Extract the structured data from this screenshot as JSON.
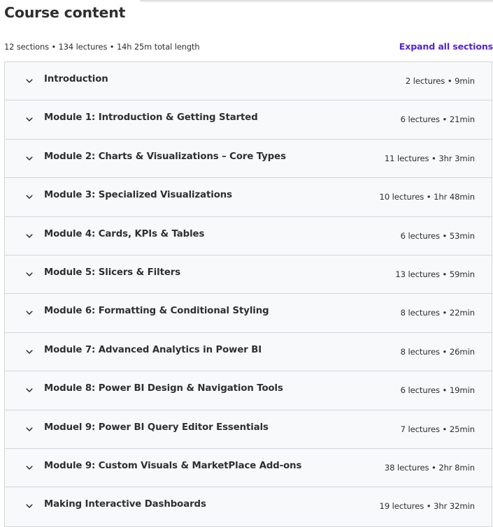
{
  "page_title": "Course content",
  "summary": "12 sections • 134 lectures • 14h 25m total length",
  "expand_all_label": "Expand all sections",
  "accent_color": "#5624d0",
  "sections": [
    {
      "title": "Introduction",
      "meta": "2 lectures • 9min"
    },
    {
      "title": "Module 1: Introduction & Getting Started",
      "meta": "6 lectures • 21min"
    },
    {
      "title": "Module 2: Charts & Visualizations – Core Types",
      "meta": "11 lectures • 3hr 3min"
    },
    {
      "title": "Module 3: Specialized Visualizations",
      "meta": "10 lectures • 1hr 48min"
    },
    {
      "title": "Module 4: Cards, KPIs & Tables",
      "meta": "6 lectures • 53min"
    },
    {
      "title": "Module 5: Slicers & Filters",
      "meta": "13 lectures • 59min"
    },
    {
      "title": "Module 6: Formatting & Conditional Styling",
      "meta": "8 lectures • 22min"
    },
    {
      "title": "Module 7: Advanced Analytics in Power BI",
      "meta": "8 lectures • 26min"
    },
    {
      "title": "Module 8: Power BI Design & Navigation Tools",
      "meta": "6 lectures • 19min"
    },
    {
      "title": "Moduel 9: Power BI Query Editor Essentials",
      "meta": "7 lectures • 25min"
    },
    {
      "title": "Module 9: Custom Visuals & MarketPlace Add-ons",
      "meta": "38 lectures • 2hr 8min"
    },
    {
      "title": "Making Interactive Dashboards",
      "meta": "19 lectures • 3hr 32min"
    }
  ],
  "icons": {
    "section_toggle": "chevron-down-icon"
  }
}
